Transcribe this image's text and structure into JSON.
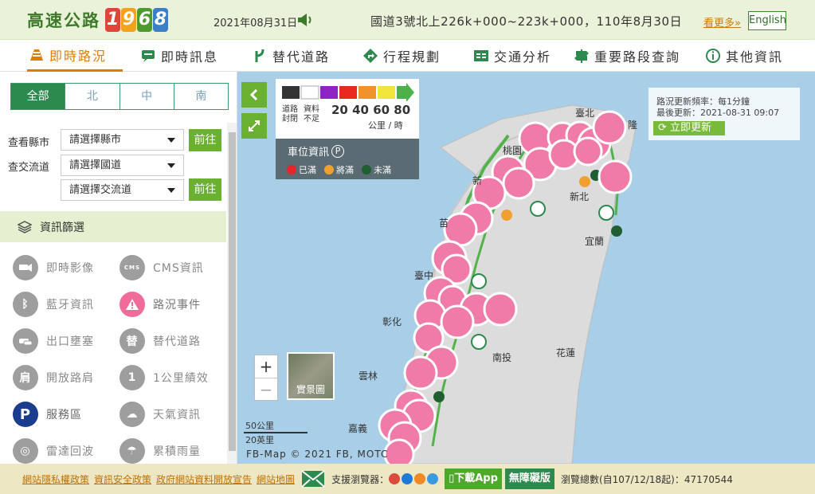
{
  "header": {
    "logo_text": "高速公路",
    "logo_digits": [
      "1",
      "9",
      "6",
      "8"
    ],
    "logo_colors": [
      "#e0453a",
      "#f2a31b",
      "#4f9a2f",
      "#3a7fc8"
    ],
    "date": "2021年08月31日",
    "marquee": "國道3號北上226k+000~223k+000，110年8月30日",
    "more_label": "看更多»",
    "english_label": "English"
  },
  "nav": {
    "items": [
      {
        "label": "即時路況",
        "icon": "traffic-cone-icon",
        "active": true
      },
      {
        "label": "即時訊息",
        "icon": "chat-icon",
        "active": false
      },
      {
        "label": "替代道路",
        "icon": "route-icon",
        "active": false
      },
      {
        "label": "行程規劃",
        "icon": "direction-icon",
        "active": false
      },
      {
        "label": "交通分析",
        "icon": "analysis-icon",
        "active": false
      },
      {
        "label": "重要路段查詢",
        "icon": "signpost-icon",
        "active": false
      },
      {
        "label": "其他資訊",
        "icon": "info-icon",
        "active": false
      }
    ]
  },
  "sidebar": {
    "region_tabs": [
      "全部",
      "北",
      "中",
      "南"
    ],
    "county_label": "查看縣市",
    "county_select": "請選擇縣市",
    "flow_label": "查交流道",
    "road_select": "請選擇國道",
    "ic_select": "請選擇交流道",
    "go_label": "前往",
    "filter_title": "資訊篩選",
    "filters": [
      {
        "label": "即時影像",
        "icon": "camera-icon",
        "glyph": ""
      },
      {
        "label": "CMS資訊",
        "icon": "cms-icon",
        "glyph": "CMS"
      },
      {
        "label": "藍牙資訊",
        "icon": "bluetooth-icon",
        "glyph": "ᛒ"
      },
      {
        "label": "路況事件",
        "icon": "warning-icon",
        "glyph": "!"
      },
      {
        "label": "出口壅塞",
        "icon": "car-queue-icon",
        "glyph": ""
      },
      {
        "label": "替代道路",
        "icon": "alternate-road-icon",
        "glyph": "替"
      },
      {
        "label": "開放路肩",
        "icon": "shoulder-icon",
        "glyph": "肩"
      },
      {
        "label": "1公里績效",
        "icon": "km-icon",
        "glyph": "1"
      },
      {
        "label": "服務區",
        "icon": "parking-icon",
        "glyph": "P"
      },
      {
        "label": "天氣資訊",
        "icon": "weather-icon",
        "glyph": "☁"
      },
      {
        "label": "雷達回波",
        "icon": "radar-icon",
        "glyph": "◎"
      },
      {
        "label": "累積雨量",
        "icon": "rain-icon",
        "glyph": "☂"
      }
    ]
  },
  "map": {
    "legend": {
      "closed": "道路 封閉",
      "no_data": "資料 不足",
      "speeds": "20 40 60 80",
      "unit": "公里 / 時"
    },
    "car_info": {
      "title": "車位資訊",
      "full": "已滿",
      "almost": "將滿",
      "available": "未滿"
    },
    "update": {
      "freq": "路況更新頻率：每1分鐘",
      "last": "最後更新：2021-08-31 09:07",
      "button": "立即更新"
    },
    "places": [
      {
        "name": "臺北"
      },
      {
        "name": "隆"
      },
      {
        "name": "桃園"
      },
      {
        "name": "新北"
      },
      {
        "name": "宜蘭"
      },
      {
        "name": "新"
      },
      {
        "name": "苗"
      },
      {
        "name": "臺中"
      },
      {
        "name": "彰化"
      },
      {
        "name": "南投"
      },
      {
        "name": "花蓮"
      },
      {
        "name": "雲林"
      },
      {
        "name": "嘉義"
      }
    ],
    "satellite_label": "實景圖",
    "scale_km": "50公里",
    "scale_mi": "20英里",
    "copyright": "FB-Map © 2021 FB, MOTC"
  },
  "footer": {
    "links": [
      "網站隱私權政策",
      "資訊安全政策",
      "政府網站資料開放宣告",
      "網站地圖"
    ],
    "browser_label": "支援瀏覽器：",
    "app_label": "下載App",
    "accessible_label": "無障礙版",
    "visitors": "瀏覽總數(自107/12/18起)：47170544"
  }
}
